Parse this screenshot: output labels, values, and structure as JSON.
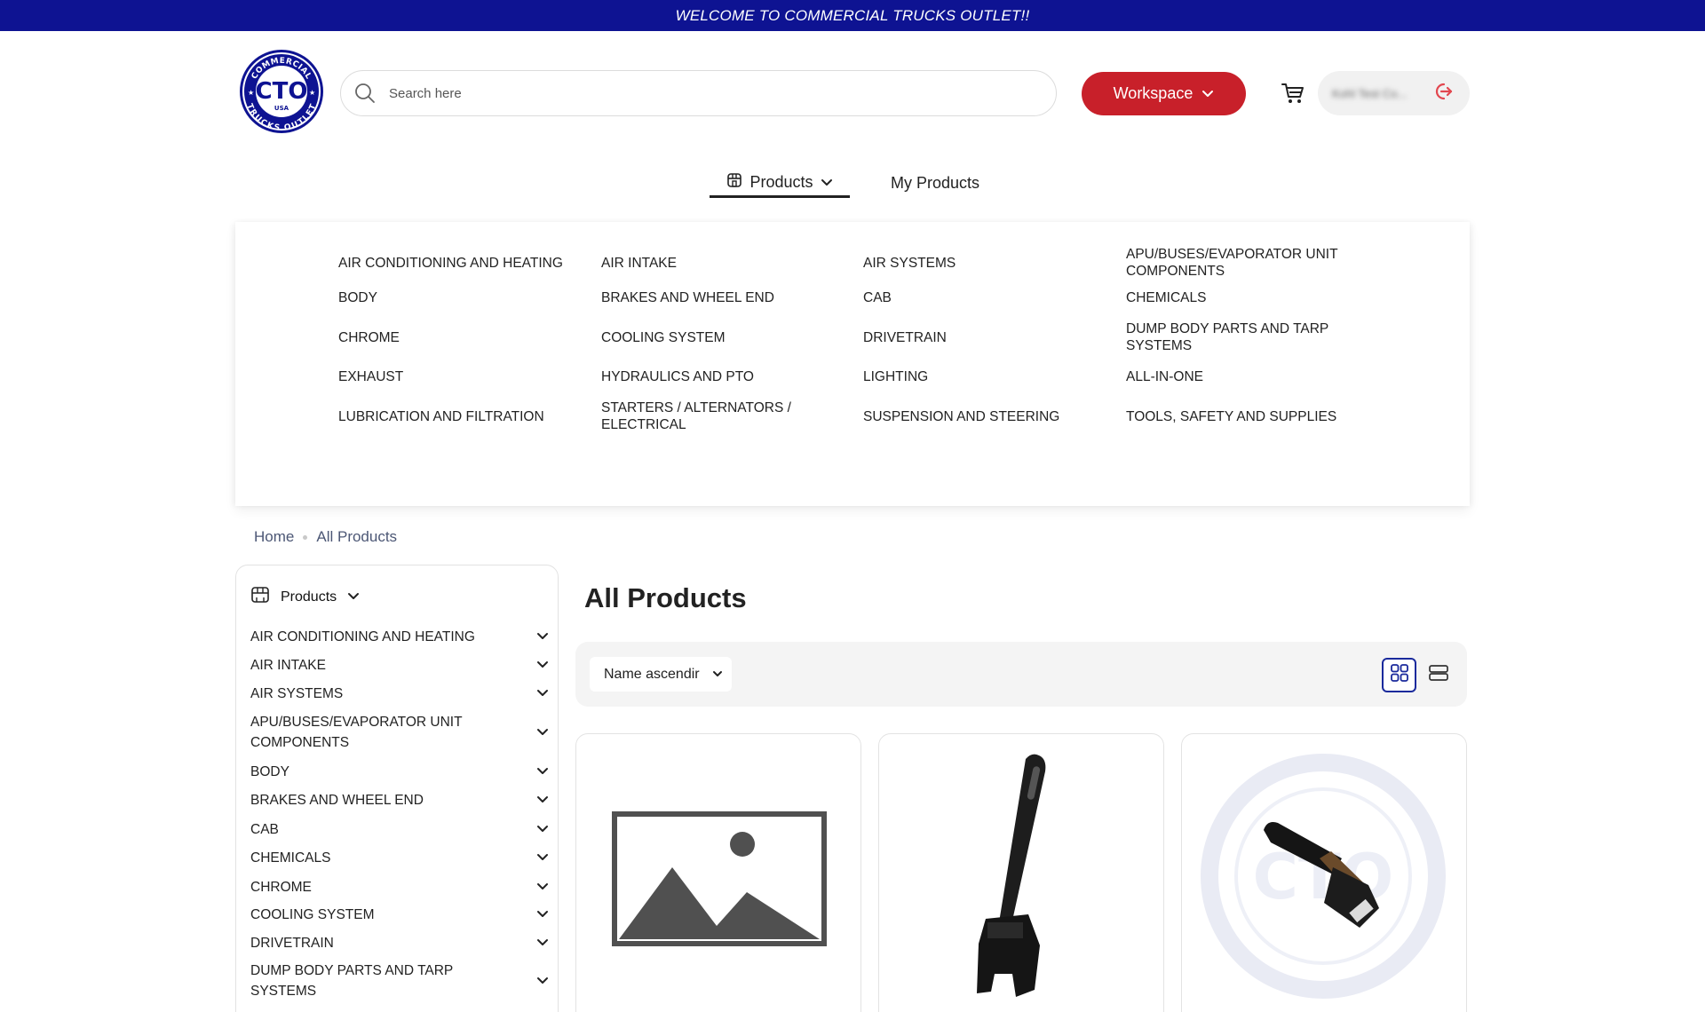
{
  "banner": {
    "text": "WELCOME TO COMMERCIAL TRUCKS OUTLET!!"
  },
  "logo": {
    "top_text": "COMMERCIAL",
    "center_text": "CTO",
    "sub_text": "USA",
    "bottom_text": "TRUCKS OUTLET"
  },
  "search": {
    "placeholder": "Search here"
  },
  "workspace_button": {
    "label": "Workspace"
  },
  "user": {
    "name": "Kohl Test Co..."
  },
  "nav": {
    "products_label": "Products",
    "my_products_label": "My Products"
  },
  "mega_menu": {
    "items": [
      "AIR CONDITIONING AND HEATING",
      "AIR INTAKE",
      "AIR SYSTEMS",
      "APU/BUSES/EVAPORATOR UNIT COMPONENTS",
      "BODY",
      "BRAKES AND WHEEL END",
      "CAB",
      "CHEMICALS",
      "CHROME",
      "COOLING SYSTEM",
      "DRIVETRAIN",
      "DUMP BODY PARTS AND TARP SYSTEMS",
      "EXHAUST",
      "HYDRAULICS AND PTO",
      "LIGHTING",
      "ALL-IN-ONE",
      "LUBRICATION AND FILTRATION",
      "STARTERS / ALTERNATORS / ELECTRICAL",
      "SUSPENSION AND STEERING",
      "TOOLS, SAFETY AND SUPPLIES"
    ]
  },
  "breadcrumb": {
    "home": "Home",
    "current": "All Products"
  },
  "sidebar": {
    "title": "Products",
    "items": [
      "AIR CONDITIONING AND HEATING",
      "AIR INTAKE",
      "AIR SYSTEMS",
      "APU/BUSES/EVAPORATOR UNIT COMPONENTS",
      "BODY",
      "BRAKES AND WHEEL END",
      "CAB",
      "CHEMICALS",
      "CHROME",
      "COOLING SYSTEM",
      "DRIVETRAIN",
      "DUMP BODY PARTS AND TARP SYSTEMS"
    ]
  },
  "main": {
    "title": "All Products",
    "sort": {
      "selected": "Name ascendir"
    }
  },
  "colors": {
    "banner": "#0e1392",
    "brand_red": "#c8202a",
    "accent_blue": "#1a2a9c"
  }
}
